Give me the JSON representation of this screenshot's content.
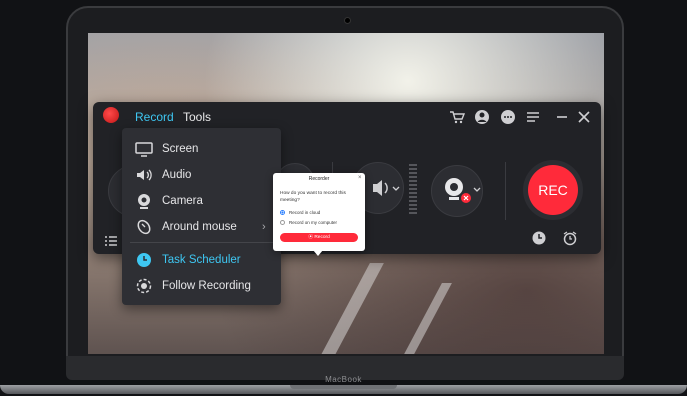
{
  "device": {
    "label": "MacBook"
  },
  "app": {
    "tabs": [
      {
        "label": "Record"
      },
      {
        "label": "Tools"
      }
    ],
    "toolbar_icons": [
      "cart-icon",
      "user-icon",
      "chat-icon",
      "menu-icon",
      "minimize-icon",
      "close-icon"
    ],
    "rec_button_label": "REC"
  },
  "menu": {
    "items": [
      {
        "label": "Screen",
        "icon": "monitor-icon"
      },
      {
        "label": "Audio",
        "icon": "speaker-icon"
      },
      {
        "label": "Camera",
        "icon": "webcam-icon"
      },
      {
        "label": "Around mouse",
        "icon": "mouse-icon"
      },
      {
        "label": "Task Scheduler",
        "icon": "clock-icon"
      },
      {
        "label": "Follow Recording",
        "icon": "target-icon"
      }
    ]
  },
  "dialog": {
    "title": "Recorder",
    "question": "How do you want to record this meeting?",
    "options": [
      {
        "label": "Record in cloud",
        "selected": true
      },
      {
        "label": "Record on my computer",
        "selected": false
      }
    ],
    "button_label": "⦿ Record"
  },
  "colors": {
    "accent": "#3ec7f2",
    "rec_red": "#ff2a3a"
  }
}
